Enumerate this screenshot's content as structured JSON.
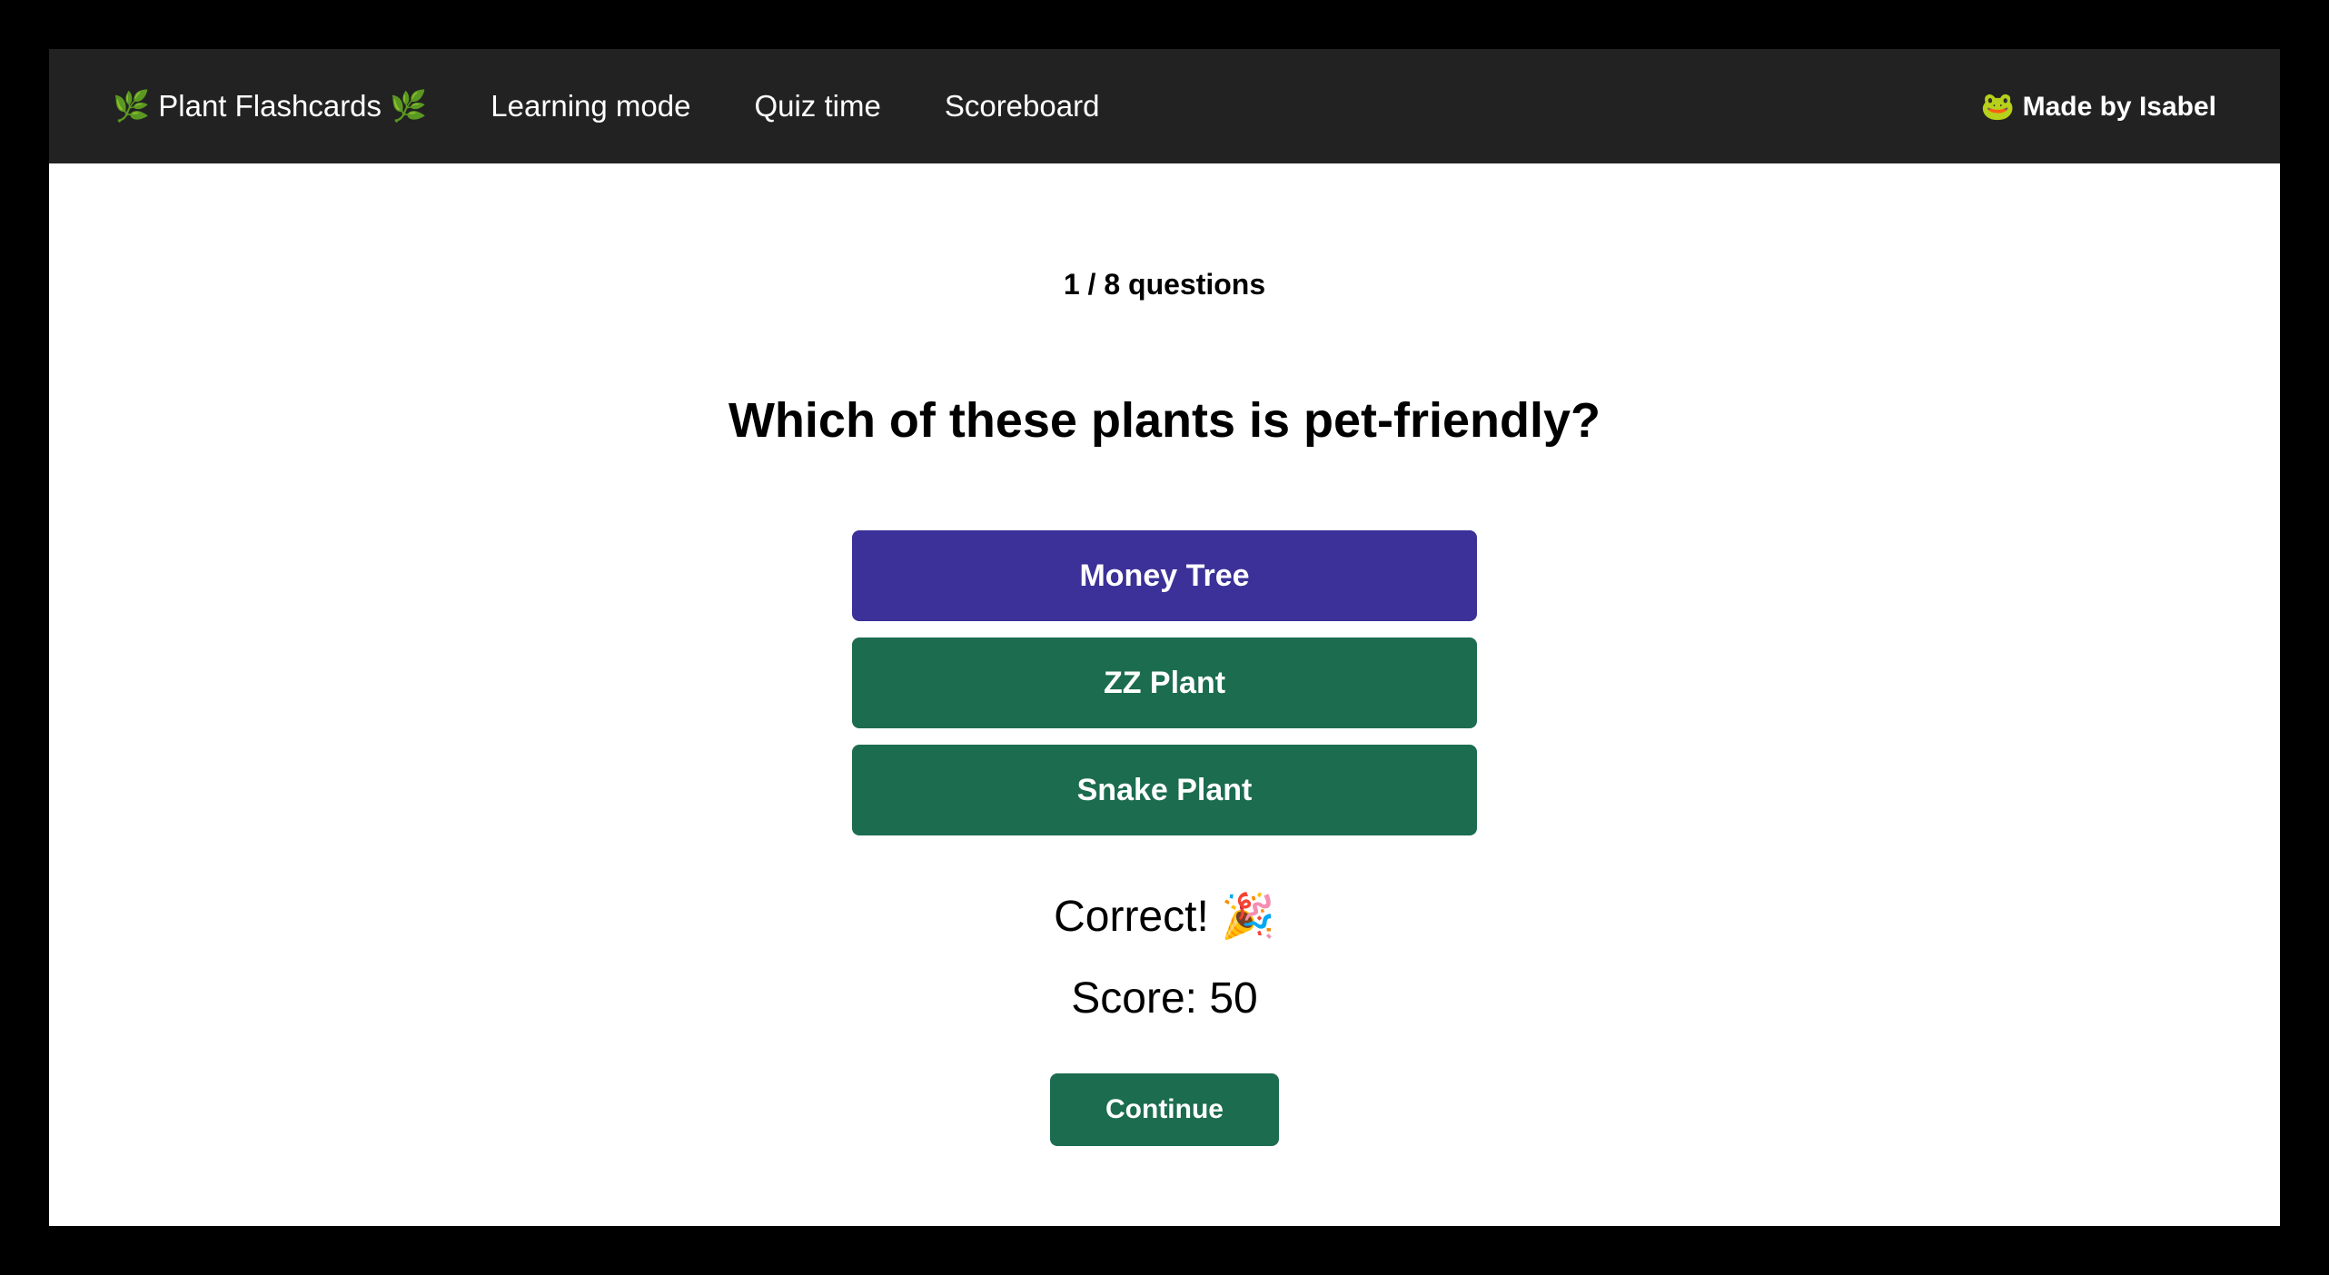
{
  "nav": {
    "brand": "🌿 Plant Flashcards 🌿",
    "links": [
      {
        "label": "Learning mode"
      },
      {
        "label": "Quiz time"
      },
      {
        "label": "Scoreboard"
      }
    ],
    "credit": "🐸 Made by Isabel"
  },
  "quiz": {
    "counter": "1 / 8 questions",
    "question": "Which of these plants is pet-friendly?",
    "options": [
      {
        "label": "Money Tree",
        "state": "selected"
      },
      {
        "label": "ZZ Plant",
        "state": "default"
      },
      {
        "label": "Snake Plant",
        "state": "default"
      }
    ],
    "feedback": "Correct! 🎉",
    "score": "Score: 50",
    "continue_label": "Continue"
  }
}
